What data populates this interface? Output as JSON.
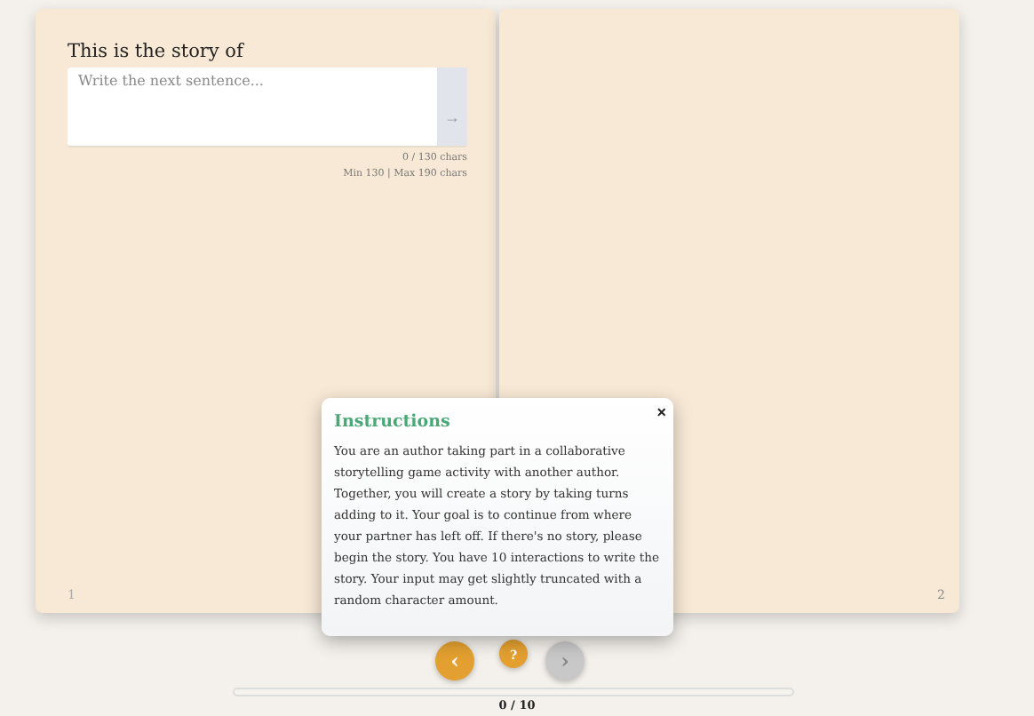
{
  "book": {
    "left_page": {
      "heading": "This is the story of",
      "input": {
        "placeholder": "Write the next sentence..."
      },
      "send_button": "→",
      "counter": "0 / 130 chars",
      "limits": "Min 130 | Max 190 chars",
      "page_number": "1"
    },
    "right_page": {
      "page_number": "2"
    }
  },
  "instructions": {
    "title": "Instructions",
    "close": "×",
    "text": "You are an author taking part in a collaborative storytelling game activity with another author. Together, you will create a story by taking turns adding to it. Your goal is to continue from where your partner has left off. If there's no story, please begin the story. You have 10 interactions to write the story. Your input may get slightly truncated with a random character amount."
  },
  "nav": {
    "prev": {
      "label": "‹",
      "disabled": false
    },
    "help": {
      "label": "?",
      "disabled": false
    },
    "next": {
      "label": "›",
      "disabled": true
    }
  },
  "progress": {
    "level": 0,
    "label": "0 / 10"
  }
}
